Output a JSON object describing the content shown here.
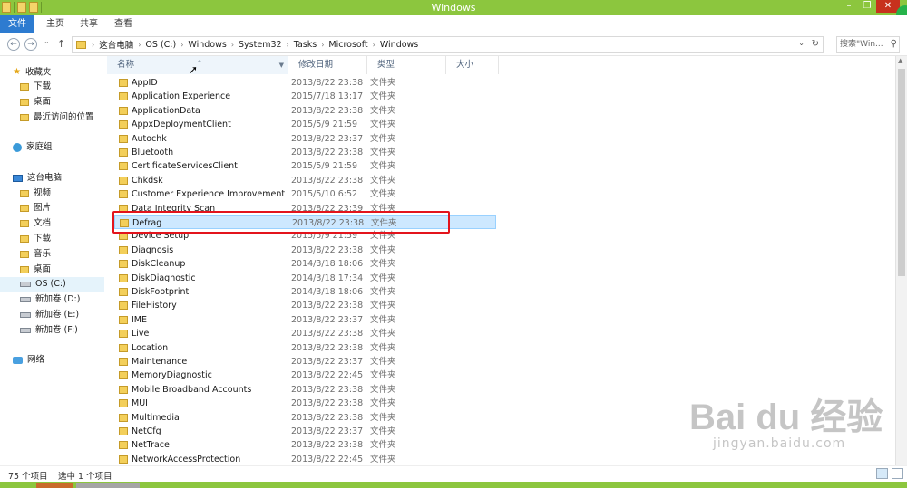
{
  "window": {
    "title": "Windows",
    "controls": {
      "minimize": "–",
      "restore": "❐",
      "close": "✕"
    }
  },
  "ribbon": {
    "tabs": [
      "文件",
      "主页",
      "共享",
      "查看"
    ]
  },
  "address": {
    "back": "←",
    "forward": "→",
    "recent": "⌄",
    "up": "↑",
    "path": [
      "这台电脑",
      "OS (C:)",
      "Windows",
      "System32",
      "Tasks",
      "Microsoft",
      "Windows"
    ],
    "separator": "›",
    "search_placeholder": "搜索\"Win...",
    "refresh": "↻",
    "dropdown": "⌄",
    "search_icon": "⚲"
  },
  "nav": {
    "items": [
      {
        "label": "收藏夹",
        "icon": "star-icon"
      },
      {
        "label": "下载",
        "icon": "folder-icon"
      },
      {
        "label": "桌面",
        "icon": "folder-icon"
      },
      {
        "label": "最近访问的位置",
        "icon": "folder-icon"
      },
      {
        "label": "家庭组",
        "icon": "homegroup-icon"
      },
      {
        "label": "这台电脑",
        "icon": "computer-icon"
      },
      {
        "label": "视频",
        "icon": "folder-icon"
      },
      {
        "label": "图片",
        "icon": "folder-icon"
      },
      {
        "label": "文档",
        "icon": "folder-icon"
      },
      {
        "label": "下载",
        "icon": "folder-icon"
      },
      {
        "label": "音乐",
        "icon": "folder-icon"
      },
      {
        "label": "桌面",
        "icon": "folder-icon"
      },
      {
        "label": "OS (C:)",
        "icon": "drive-icon"
      },
      {
        "label": "新加卷 (D:)",
        "icon": "drive-icon"
      },
      {
        "label": "新加卷 (E:)",
        "icon": "drive-icon"
      },
      {
        "label": "新加卷 (F:)",
        "icon": "drive-icon"
      },
      {
        "label": "网络",
        "icon": "network-icon"
      }
    ]
  },
  "columns": {
    "name": "名称",
    "date": "修改日期",
    "type": "类型",
    "size": "大小"
  },
  "files": [
    {
      "name": "AppID",
      "date": "2013/8/22 23:38",
      "type": "文件夹"
    },
    {
      "name": "Application Experience",
      "date": "2015/7/18 13:17",
      "type": "文件夹"
    },
    {
      "name": "ApplicationData",
      "date": "2013/8/22 23:38",
      "type": "文件夹"
    },
    {
      "name": "AppxDeploymentClient",
      "date": "2015/5/9 21:59",
      "type": "文件夹"
    },
    {
      "name": "Autochk",
      "date": "2013/8/22 23:37",
      "type": "文件夹"
    },
    {
      "name": "Bluetooth",
      "date": "2013/8/22 23:38",
      "type": "文件夹"
    },
    {
      "name": "CertificateServicesClient",
      "date": "2015/5/9 21:59",
      "type": "文件夹"
    },
    {
      "name": "Chkdsk",
      "date": "2013/8/22 23:38",
      "type": "文件夹"
    },
    {
      "name": "Customer Experience Improvement P...",
      "date": "2015/5/10 6:52",
      "type": "文件夹"
    },
    {
      "name": "Data Integrity Scan",
      "date": "2013/8/22 23:39",
      "type": "文件夹"
    },
    {
      "name": "Defrag",
      "date": "2013/8/22 23:38",
      "type": "文件夹",
      "selected": true
    },
    {
      "name": "Device Setup",
      "date": "2015/5/9 21:59",
      "type": "文件夹"
    },
    {
      "name": "Diagnosis",
      "date": "2013/8/22 23:38",
      "type": "文件夹"
    },
    {
      "name": "DiskCleanup",
      "date": "2014/3/18 18:06",
      "type": "文件夹"
    },
    {
      "name": "DiskDiagnostic",
      "date": "2014/3/18 17:34",
      "type": "文件夹"
    },
    {
      "name": "DiskFootprint",
      "date": "2014/3/18 18:06",
      "type": "文件夹"
    },
    {
      "name": "FileHistory",
      "date": "2013/8/22 23:38",
      "type": "文件夹"
    },
    {
      "name": "IME",
      "date": "2013/8/22 23:37",
      "type": "文件夹"
    },
    {
      "name": "Live",
      "date": "2013/8/22 23:38",
      "type": "文件夹"
    },
    {
      "name": "Location",
      "date": "2013/8/22 23:38",
      "type": "文件夹"
    },
    {
      "name": "Maintenance",
      "date": "2013/8/22 23:37",
      "type": "文件夹"
    },
    {
      "name": "MemoryDiagnostic",
      "date": "2013/8/22 22:45",
      "type": "文件夹"
    },
    {
      "name": "Mobile Broadband Accounts",
      "date": "2013/8/22 23:38",
      "type": "文件夹"
    },
    {
      "name": "MUI",
      "date": "2013/8/22 23:38",
      "type": "文件夹"
    },
    {
      "name": "Multimedia",
      "date": "2013/8/22 23:38",
      "type": "文件夹"
    },
    {
      "name": "NetCfg",
      "date": "2013/8/22 23:37",
      "type": "文件夹"
    },
    {
      "name": "NetTrace",
      "date": "2013/8/22 23:38",
      "type": "文件夹"
    },
    {
      "name": "NetworkAccessProtection",
      "date": "2013/8/22 22:45",
      "type": "文件夹"
    }
  ],
  "status": {
    "count": "75 个项目",
    "selected": "选中 1 个项目"
  },
  "watermark": {
    "main": "Bai du 经验",
    "sub": "jingyan.baidu.com"
  },
  "colors": {
    "titlebar": "#8cc63e",
    "file_tab": "#2d7bd0",
    "selection": "#cde8ff",
    "highlight_box": "#e3141c"
  }
}
